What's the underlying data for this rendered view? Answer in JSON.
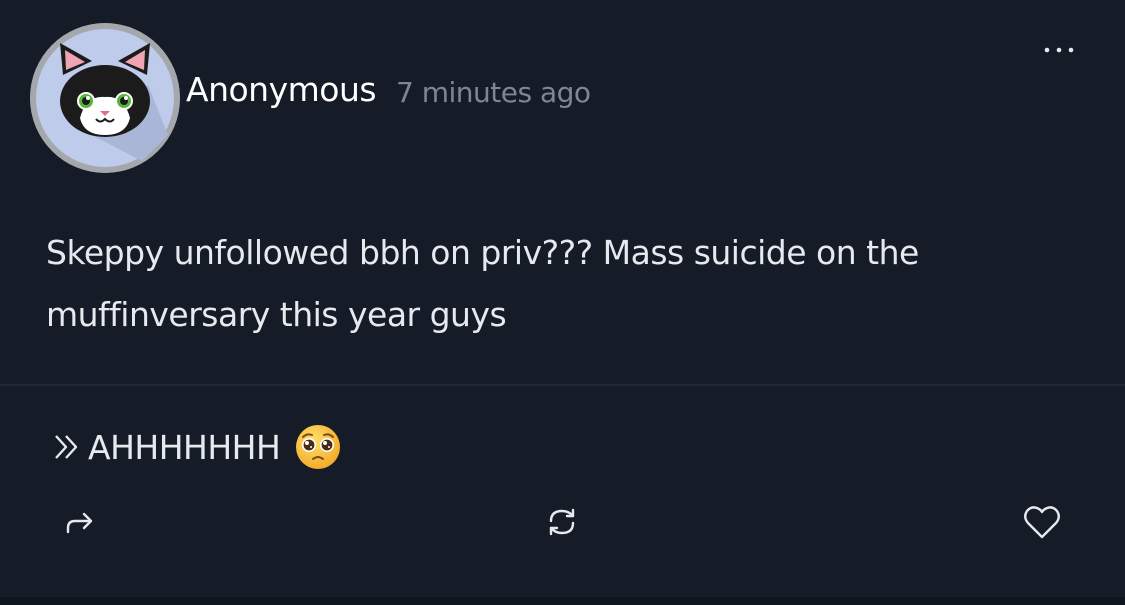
{
  "post": {
    "author": "Anonymous",
    "time_ago": "7 minutes ago",
    "body": "Skeppy unfollowed bbh on priv??? Mass suicide on the muffinversary this year guys",
    "avatar_icon": "cat-face-icon",
    "more_icon": "more-dots-icon"
  },
  "reply": {
    "text": "AHHHHHHH",
    "prefix_icon": "double-chevron-right-icon",
    "emoji": "pleading-face-emoji"
  },
  "actions": {
    "share_icon": "share-arrow-icon",
    "repost_icon": "repost-icon",
    "like_icon": "heart-icon"
  },
  "colors": {
    "background": "#151c27",
    "text": "#e6e9ee",
    "muted": "#7d8794",
    "avatar_bg": "#bfcbea"
  }
}
